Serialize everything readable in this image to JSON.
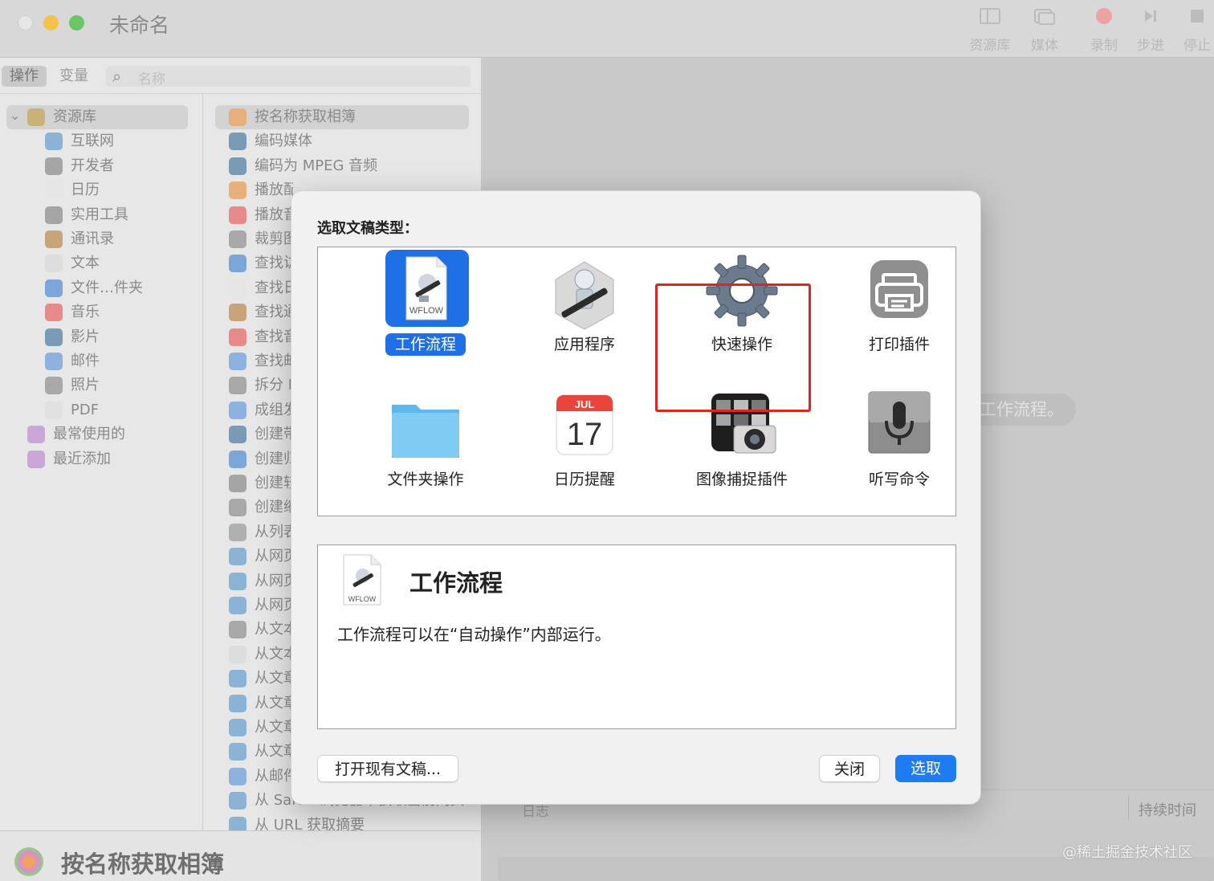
{
  "window": {
    "title": "未命名"
  },
  "toolbar": [
    {
      "label": "资源库",
      "icon": "library-icon"
    },
    {
      "label": "媒体",
      "icon": "media-icon"
    },
    {
      "label": "录制",
      "icon": "record-icon"
    },
    {
      "label": "步进",
      "icon": "step-icon"
    },
    {
      "label": "停止",
      "icon": "stop-icon"
    }
  ],
  "library": {
    "tabs": {
      "actions": "操作",
      "variables": "变量"
    },
    "search_placeholder": "名称",
    "tree": [
      {
        "label": "资源库",
        "icon": "library-folder-icon",
        "color": "#c9b27a"
      },
      {
        "label": "互联网",
        "icon": "globe-icon",
        "color": "#8ab3d6"
      },
      {
        "label": "开发者",
        "icon": "tools-icon",
        "color": "#a5a5a5"
      },
      {
        "label": "日历",
        "icon": "calendar-icon",
        "color": "#e6e6e6"
      },
      {
        "label": "实用工具",
        "icon": "tools-icon",
        "color": "#a5a5a5"
      },
      {
        "label": "通讯录",
        "icon": "contacts-icon",
        "color": "#c7a47a"
      },
      {
        "label": "文本",
        "icon": "text-icon",
        "color": "#dddddd"
      },
      {
        "label": "文件…件夹",
        "icon": "finder-icon",
        "color": "#7aa6d9"
      },
      {
        "label": "音乐",
        "icon": "music-icon",
        "color": "#e68a8a"
      },
      {
        "label": "影片",
        "icon": "movie-icon",
        "color": "#7a9bb5"
      },
      {
        "label": "邮件",
        "icon": "mail-icon",
        "color": "#8db2e0"
      },
      {
        "label": "照片",
        "icon": "photo-icon",
        "color": "#a8a8a8"
      },
      {
        "label": "PDF",
        "icon": "pdf-icon",
        "color": "#e1e1e1"
      },
      {
        "label": "最常使用的",
        "icon": "smart-folder-icon",
        "color": "#c9a7d6"
      },
      {
        "label": "最近添加",
        "icon": "smart-folder-icon",
        "color": "#c9a7d6"
      }
    ],
    "actions": [
      {
        "label": "按名称获取相簿",
        "icon": "photos-icon",
        "color": "#e7b07a"
      },
      {
        "label": "编码媒体",
        "icon": "quicktime-icon",
        "color": "#7a9bb5"
      },
      {
        "label": "编码为 MPEG 音频",
        "icon": "quicktime-icon",
        "color": "#7a9bb5"
      },
      {
        "label": "播放配音乐的幻灯片放映",
        "icon": "photos-icon",
        "color": "#e7b07a"
      },
      {
        "label": "播放音",
        "icon": "music-icon",
        "color": "#e68a8a"
      },
      {
        "label": "裁剪图",
        "icon": "preview-icon",
        "color": "#a8a8a8"
      },
      {
        "label": "查找访",
        "icon": "finder-icon",
        "color": "#7aa6d9"
      },
      {
        "label": "查找日",
        "icon": "calendar-icon",
        "color": "#e6e6e6"
      },
      {
        "label": "查找通",
        "icon": "contacts-icon",
        "color": "#c7a47a"
      },
      {
        "label": "查找音",
        "icon": "music-icon",
        "color": "#e68a8a"
      },
      {
        "label": "查找邮",
        "icon": "mail-icon",
        "color": "#8db2e0"
      },
      {
        "label": "拆分 P",
        "icon": "preview-icon",
        "color": "#a8a8a8"
      },
      {
        "label": "成组发",
        "icon": "mail-icon",
        "color": "#8db2e0"
      },
      {
        "label": "创建带",
        "icon": "quicktime-icon",
        "color": "#7a9bb5"
      },
      {
        "label": "创建归",
        "icon": "finder-icon",
        "color": "#7aa6d9"
      },
      {
        "label": "创建较",
        "icon": "tools-icon",
        "color": "#a5a5a5"
      },
      {
        "label": "创建缩",
        "icon": "preview-icon",
        "color": "#a8a8a8"
      },
      {
        "label": "从列表",
        "icon": "automator-icon",
        "color": "#b0b0b0"
      },
      {
        "label": "从网页",
        "icon": "safari-icon",
        "color": "#8ab3d6"
      },
      {
        "label": "从网页",
        "icon": "safari-icon",
        "color": "#8ab3d6"
      },
      {
        "label": "从网页",
        "icon": "safari-icon",
        "color": "#8ab3d6"
      },
      {
        "label": "从文本",
        "icon": "preview-icon",
        "color": "#a8a8a8"
      },
      {
        "label": "从文本",
        "icon": "text-icon",
        "color": "#dddddd"
      },
      {
        "label": "从文章",
        "icon": "safari-icon",
        "color": "#8ab3d6"
      },
      {
        "label": "从文章",
        "icon": "safari-icon",
        "color": "#8ab3d6"
      },
      {
        "label": "从文章",
        "icon": "safari-icon",
        "color": "#8ab3d6"
      },
      {
        "label": "从文章",
        "icon": "safari-icon",
        "color": "#8ab3d6"
      },
      {
        "label": "从邮件",
        "icon": "mail-icon",
        "color": "#8db2e0"
      },
      {
        "label": "从 Safari 浏览器中获取当前网页",
        "icon": "safari-icon",
        "color": "#8ab3d6"
      },
      {
        "label": "从 URL 获取摘要",
        "icon": "safari-icon",
        "color": "#8ab3d6"
      }
    ],
    "selected_action_title": "按名称获取相簿"
  },
  "workflow": {
    "hint_pill": "工作流程。",
    "log_label": "日志",
    "duration_label": "持续时间"
  },
  "watermark": "@稀土掘金技术社区",
  "dialog": {
    "title": "选取文稿类型：",
    "types": [
      {
        "label": "工作流程",
        "icon": "workflow-document-icon",
        "selected": true
      },
      {
        "label": "应用程序",
        "icon": "automator-robot-icon",
        "selected": false
      },
      {
        "label": "快速操作",
        "icon": "gear-icon",
        "selected": false,
        "highlighted": true
      },
      {
        "label": "打印插件",
        "icon": "printer-icon",
        "selected": false
      },
      {
        "label": "文件夹操作",
        "icon": "folder-icon",
        "selected": false
      },
      {
        "label": "日历提醒",
        "icon": "calendar-icon",
        "selected": false,
        "calendar_month": "JUL",
        "calendar_day": "17"
      },
      {
        "label": "图像捕捉插件",
        "icon": "image-capture-icon",
        "selected": false
      },
      {
        "label": "听写命令",
        "icon": "microphone-icon",
        "selected": false
      }
    ],
    "doc_icon_caption": "WFLOW",
    "description": {
      "title": "工作流程",
      "text": "工作流程可以在“自动操作”内部运行。"
    },
    "buttons": {
      "open_existing": "打开现有文稿...",
      "close": "关闭",
      "choose": "选取"
    },
    "colors": {
      "accent": "#1f6fe6",
      "highlight": "#e0251b"
    }
  }
}
